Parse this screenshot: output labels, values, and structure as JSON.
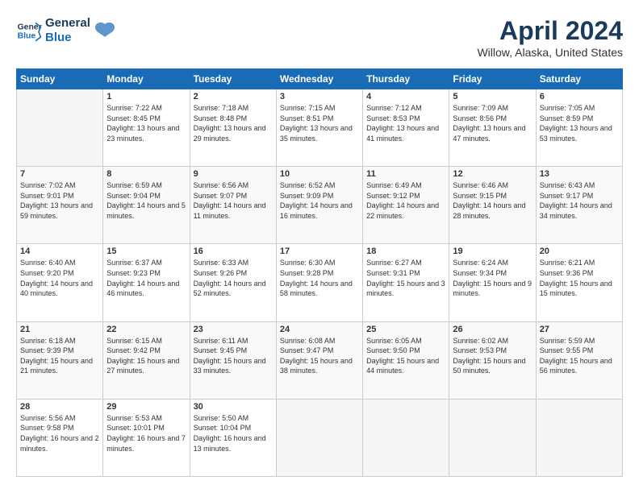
{
  "logo": {
    "line1": "General",
    "line2": "Blue"
  },
  "title": "April 2024",
  "location": "Willow, Alaska, United States",
  "days_of_week": [
    "Sunday",
    "Monday",
    "Tuesday",
    "Wednesday",
    "Thursday",
    "Friday",
    "Saturday"
  ],
  "weeks": [
    [
      {
        "day": "",
        "empty": true
      },
      {
        "day": "1",
        "sunrise": "7:22 AM",
        "sunset": "8:45 PM",
        "daylight": "13 hours and 23 minutes."
      },
      {
        "day": "2",
        "sunrise": "7:18 AM",
        "sunset": "8:48 PM",
        "daylight": "13 hours and 29 minutes."
      },
      {
        "day": "3",
        "sunrise": "7:15 AM",
        "sunset": "8:51 PM",
        "daylight": "13 hours and 35 minutes."
      },
      {
        "day": "4",
        "sunrise": "7:12 AM",
        "sunset": "8:53 PM",
        "daylight": "13 hours and 41 minutes."
      },
      {
        "day": "5",
        "sunrise": "7:09 AM",
        "sunset": "8:56 PM",
        "daylight": "13 hours and 47 minutes."
      },
      {
        "day": "6",
        "sunrise": "7:05 AM",
        "sunset": "8:59 PM",
        "daylight": "13 hours and 53 minutes."
      }
    ],
    [
      {
        "day": "7",
        "sunrise": "7:02 AM",
        "sunset": "9:01 PM",
        "daylight": "13 hours and 59 minutes."
      },
      {
        "day": "8",
        "sunrise": "6:59 AM",
        "sunset": "9:04 PM",
        "daylight": "14 hours and 5 minutes."
      },
      {
        "day": "9",
        "sunrise": "6:56 AM",
        "sunset": "9:07 PM",
        "daylight": "14 hours and 11 minutes."
      },
      {
        "day": "10",
        "sunrise": "6:52 AM",
        "sunset": "9:09 PM",
        "daylight": "14 hours and 16 minutes."
      },
      {
        "day": "11",
        "sunrise": "6:49 AM",
        "sunset": "9:12 PM",
        "daylight": "14 hours and 22 minutes."
      },
      {
        "day": "12",
        "sunrise": "6:46 AM",
        "sunset": "9:15 PM",
        "daylight": "14 hours and 28 minutes."
      },
      {
        "day": "13",
        "sunrise": "6:43 AM",
        "sunset": "9:17 PM",
        "daylight": "14 hours and 34 minutes."
      }
    ],
    [
      {
        "day": "14",
        "sunrise": "6:40 AM",
        "sunset": "9:20 PM",
        "daylight": "14 hours and 40 minutes."
      },
      {
        "day": "15",
        "sunrise": "6:37 AM",
        "sunset": "9:23 PM",
        "daylight": "14 hours and 46 minutes."
      },
      {
        "day": "16",
        "sunrise": "6:33 AM",
        "sunset": "9:26 PM",
        "daylight": "14 hours and 52 minutes."
      },
      {
        "day": "17",
        "sunrise": "6:30 AM",
        "sunset": "9:28 PM",
        "daylight": "14 hours and 58 minutes."
      },
      {
        "day": "18",
        "sunrise": "6:27 AM",
        "sunset": "9:31 PM",
        "daylight": "15 hours and 3 minutes."
      },
      {
        "day": "19",
        "sunrise": "6:24 AM",
        "sunset": "9:34 PM",
        "daylight": "15 hours and 9 minutes."
      },
      {
        "day": "20",
        "sunrise": "6:21 AM",
        "sunset": "9:36 PM",
        "daylight": "15 hours and 15 minutes."
      }
    ],
    [
      {
        "day": "21",
        "sunrise": "6:18 AM",
        "sunset": "9:39 PM",
        "daylight": "15 hours and 21 minutes."
      },
      {
        "day": "22",
        "sunrise": "6:15 AM",
        "sunset": "9:42 PM",
        "daylight": "15 hours and 27 minutes."
      },
      {
        "day": "23",
        "sunrise": "6:11 AM",
        "sunset": "9:45 PM",
        "daylight": "15 hours and 33 minutes."
      },
      {
        "day": "24",
        "sunrise": "6:08 AM",
        "sunset": "9:47 PM",
        "daylight": "15 hours and 38 minutes."
      },
      {
        "day": "25",
        "sunrise": "6:05 AM",
        "sunset": "9:50 PM",
        "daylight": "15 hours and 44 minutes."
      },
      {
        "day": "26",
        "sunrise": "6:02 AM",
        "sunset": "9:53 PM",
        "daylight": "15 hours and 50 minutes."
      },
      {
        "day": "27",
        "sunrise": "5:59 AM",
        "sunset": "9:55 PM",
        "daylight": "15 hours and 56 minutes."
      }
    ],
    [
      {
        "day": "28",
        "sunrise": "5:56 AM",
        "sunset": "9:58 PM",
        "daylight": "16 hours and 2 minutes."
      },
      {
        "day": "29",
        "sunrise": "5:53 AM",
        "sunset": "10:01 PM",
        "daylight": "16 hours and 7 minutes."
      },
      {
        "day": "30",
        "sunrise": "5:50 AM",
        "sunset": "10:04 PM",
        "daylight": "16 hours and 13 minutes."
      },
      {
        "day": "",
        "empty": true
      },
      {
        "day": "",
        "empty": true
      },
      {
        "day": "",
        "empty": true
      },
      {
        "day": "",
        "empty": true
      }
    ]
  ]
}
